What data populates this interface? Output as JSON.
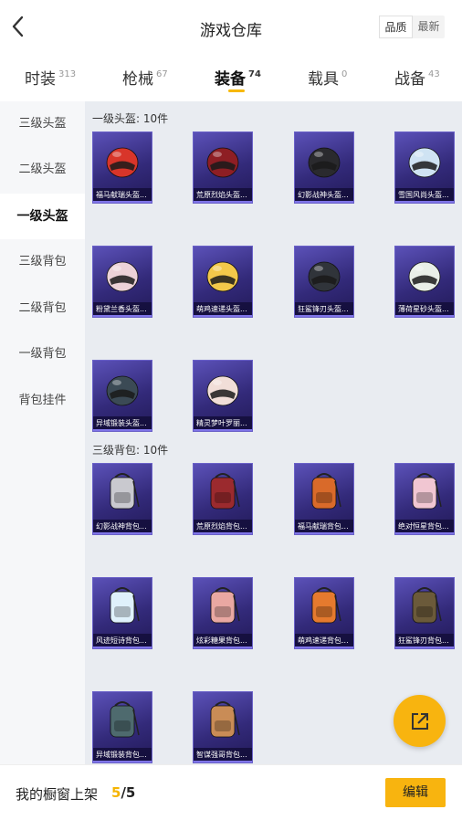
{
  "header": {
    "title": "游戏仓库",
    "sort_options": [
      "品质",
      "最新"
    ]
  },
  "tabs": [
    {
      "label": "时装",
      "count": "313"
    },
    {
      "label": "枪械",
      "count": "67"
    },
    {
      "label": "装备",
      "count": "74",
      "active": true
    },
    {
      "label": "载具",
      "count": "0"
    },
    {
      "label": "战备",
      "count": "43"
    }
  ],
  "sidebar": {
    "items": [
      "三级头盔",
      "二级头盔",
      "一级头盔",
      "三级背包",
      "二级背包",
      "一级背包",
      "背包挂件"
    ],
    "active_index": 2
  },
  "sections": [
    {
      "title": "一级头盔: 10件",
      "items": [
        {
          "label": "福马献瑞头盔...",
          "icon": "helmet-icon",
          "color": "#d8352a"
        },
        {
          "label": "荒原烈焰头盔...",
          "icon": "helmet-icon",
          "color": "#8e1e24"
        },
        {
          "label": "幻影战神头盔...",
          "icon": "helmet-icon",
          "color": "#2a2a2e"
        },
        {
          "label": "雪国风尚头盔...",
          "icon": "helmet-icon",
          "color": "#cfe3f3"
        },
        {
          "label": "粉黛兰香头盔...",
          "icon": "helmet-icon",
          "color": "#ecd2d8"
        },
        {
          "label": "萌鸡速递头盔...",
          "icon": "helmet-icon",
          "color": "#f3c84a"
        },
        {
          "label": "狂鲨锋刃头盔...",
          "icon": "helmet-icon",
          "color": "#30343a"
        },
        {
          "label": "薄荷星砂头盔...",
          "icon": "helmet-icon",
          "color": "#e9efe8"
        },
        {
          "label": "异域锻装头盔...",
          "icon": "helmet-icon",
          "color": "#3b4a55"
        },
        {
          "label": "精灵梦叶罗丽...",
          "icon": "helmet-icon",
          "color": "#f1ded8"
        }
      ]
    },
    {
      "title": "三级背包: 10件",
      "items": [
        {
          "label": "幻影战神背包...",
          "icon": "backpack-icon",
          "color": "#c9c9cf"
        },
        {
          "label": "荒原烈焰背包...",
          "icon": "backpack-icon",
          "color": "#9b2a2e"
        },
        {
          "label": "福马献瑞背包...",
          "icon": "backpack-icon",
          "color": "#d96a2a"
        },
        {
          "label": "绝对恒星背包...",
          "icon": "backpack-icon",
          "color": "#f1c6d2"
        },
        {
          "label": "风迹短诗背包...",
          "icon": "backpack-icon",
          "color": "#dff1fb"
        },
        {
          "label": "炫彩糖果背包...",
          "icon": "backpack-icon",
          "color": "#e9a8a2"
        },
        {
          "label": "萌鸡速递背包...",
          "icon": "backpack-icon",
          "color": "#e57a2e"
        },
        {
          "label": "狂鲨锋刃背包...",
          "icon": "backpack-icon",
          "color": "#6b5a3a"
        },
        {
          "label": "异域锻装背包...",
          "icon": "backpack-icon",
          "color": "#4e6a6e"
        },
        {
          "label": "智谋强哥背包...",
          "icon": "backpack-icon",
          "color": "#c98c56"
        }
      ]
    }
  ],
  "bottom": {
    "shelf_label": "我的橱窗上架",
    "current": "5",
    "separator": "/",
    "total": "5",
    "edit_label": "编辑"
  },
  "colors": {
    "accent": "#f8b40f",
    "card_bg": "#3a2f8a",
    "content_bg": "#e9ecf1"
  }
}
